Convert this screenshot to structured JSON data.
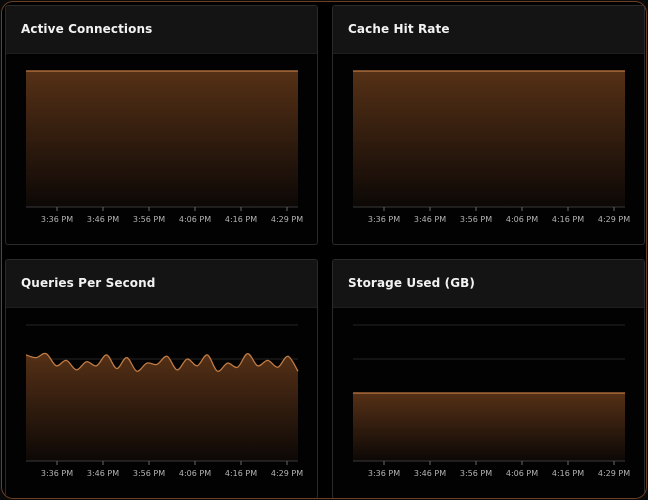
{
  "panels": [
    {
      "id": "active-connections",
      "title": "Active Connections",
      "chart_data": {
        "type": "area",
        "x": [
          "3:36 PM",
          "3:46 PM",
          "3:56 PM",
          "4:06 PM",
          "4:16 PM",
          "4:29 PM"
        ],
        "ylim": [
          0,
          1
        ],
        "grid": true,
        "series": [
          {
            "values": [
              1,
              1,
              1,
              1,
              1,
              1,
              1,
              1,
              1,
              1,
              1,
              1,
              1,
              1,
              1,
              1,
              1,
              1,
              1,
              1,
              1,
              1,
              1,
              1,
              1
            ]
          }
        ]
      }
    },
    {
      "id": "cache-hit-rate",
      "title": "Cache Hit Rate",
      "chart_data": {
        "type": "area",
        "x": [
          "3:36 PM",
          "3:46 PM",
          "3:56 PM",
          "4:06 PM",
          "4:16 PM",
          "4:29 PM"
        ],
        "ylim": [
          0,
          1
        ],
        "grid": true,
        "series": [
          {
            "values": [
              1,
              1,
              1,
              1,
              1,
              1,
              1,
              1,
              1,
              1,
              1,
              1,
              1,
              1,
              1,
              1,
              1,
              1,
              1,
              1,
              1,
              1,
              1,
              1,
              1
            ]
          }
        ]
      }
    },
    {
      "id": "queries-per-second",
      "title": "Queries Per Second",
      "chart_data": {
        "type": "area",
        "x": [
          "3:36 PM",
          "3:46 PM",
          "3:56 PM",
          "4:06 PM",
          "4:16 PM",
          "4:29 PM"
        ],
        "ylim": [
          0,
          1
        ],
        "grid": true,
        "series": [
          {
            "values": [
              0.78,
              0.76,
              0.79,
              0.7,
              0.74,
              0.67,
              0.73,
              0.7,
              0.78,
              0.68,
              0.76,
              0.66,
              0.72,
              0.71,
              0.77,
              0.67,
              0.75,
              0.7,
              0.78,
              0.66,
              0.72,
              0.69,
              0.79,
              0.7,
              0.74,
              0.69,
              0.77,
              0.66
            ]
          }
        ]
      }
    },
    {
      "id": "storage-used",
      "title": "Storage Used (GB)",
      "chart_data": {
        "type": "area",
        "x": [
          "3:36 PM",
          "3:46 PM",
          "3:56 PM",
          "4:06 PM",
          "4:16 PM",
          "4:29 PM"
        ],
        "ylim": [
          0,
          1
        ],
        "grid": true,
        "series": [
          {
            "values": [
              0.5,
              0.5,
              0.5,
              0.5,
              0.5,
              0.5,
              0.5,
              0.5,
              0.5,
              0.5,
              0.5,
              0.5,
              0.5,
              0.5,
              0.5,
              0.5,
              0.5,
              0.5,
              0.5,
              0.5,
              0.5,
              0.5,
              0.5,
              0.5,
              0.5
            ]
          }
        ]
      }
    }
  ],
  "colors": {
    "line": "#c07a44",
    "fill_top": "#5a3317",
    "fill_bottom": "#0d0806",
    "grid": "#242424",
    "axis_text": "#b4b4b4"
  }
}
